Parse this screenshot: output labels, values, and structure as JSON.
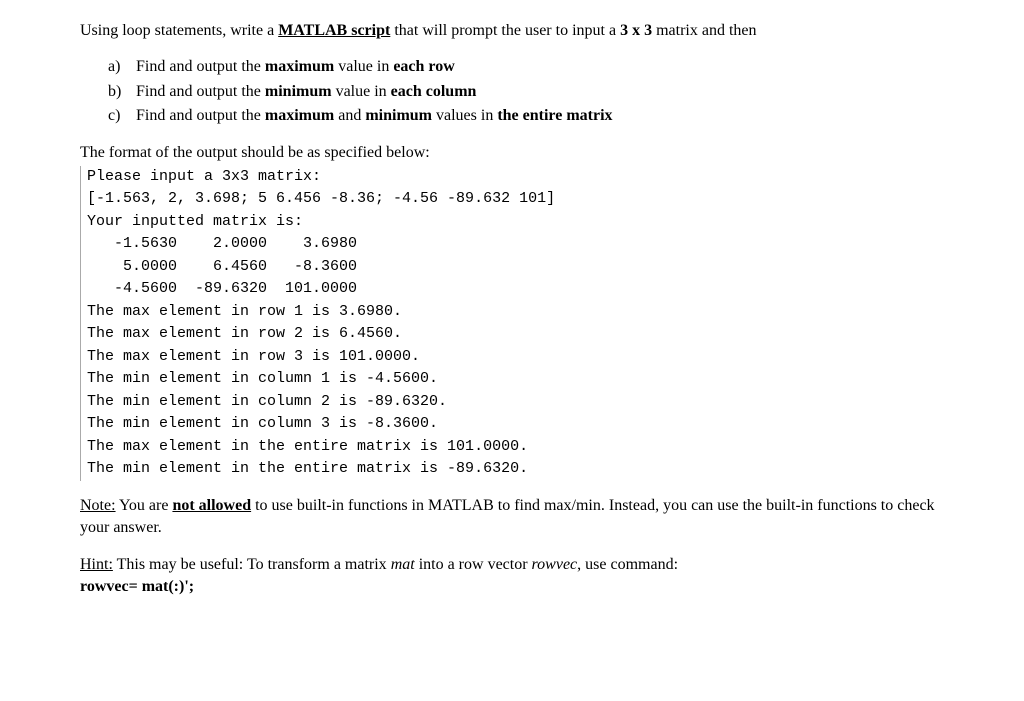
{
  "intro": {
    "p1a": "Using loop statements, write a ",
    "p1b": "MATLAB script",
    "p1c": " that will prompt the user to input a ",
    "p1d": "3 x 3",
    "p1e": " matrix and then"
  },
  "tasks": {
    "a": {
      "marker": "a)",
      "pre": "Find and output the ",
      "k1": "maximum",
      "mid": " value in ",
      "k2": "each row"
    },
    "b": {
      "marker": "b)",
      "pre": "Find and output the ",
      "k1": "minimum",
      "mid": " value in ",
      "k2": "each column"
    },
    "c": {
      "marker": "c)",
      "pre": "Find and output the ",
      "k1": "maximum",
      "and": " and ",
      "k2": "minimum",
      "mid": " values in ",
      "k3": "the entire matrix"
    }
  },
  "formatLabel": "The format of the output should be as specified below:",
  "code": "Please input a 3x3 matrix:\n[-1.563, 2, 3.698; 5 6.456 -8.36; -4.56 -89.632 101]\nYour inputted matrix is:\n   -1.5630    2.0000    3.6980\n    5.0000    6.4560   -8.3600\n   -4.5600  -89.6320  101.0000\nThe max element in row 1 is 3.6980.\nThe max element in row 2 is 6.4560.\nThe max element in row 3 is 101.0000.\nThe min element in column 1 is -4.5600.\nThe min element in column 2 is -89.6320.\nThe min element in column 3 is -8.3600.\nThe max element in the entire matrix is 101.0000.\nThe min element in the entire matrix is -89.6320.",
  "note": {
    "label": "Note:",
    "p1": " You are ",
    "p2": "not allowed",
    "p3": " to use built-in functions in MATLAB to find max/min. Instead, you can use the built-in functions to check your answer."
  },
  "hint": {
    "label": "Hint:",
    "p1": " This may be useful: To transform a matrix ",
    "m1": "mat",
    "p2": " into a row vector ",
    "m2": "rowvec",
    "p3": ", use command:",
    "cmd": "rowvec= mat(:)';"
  }
}
